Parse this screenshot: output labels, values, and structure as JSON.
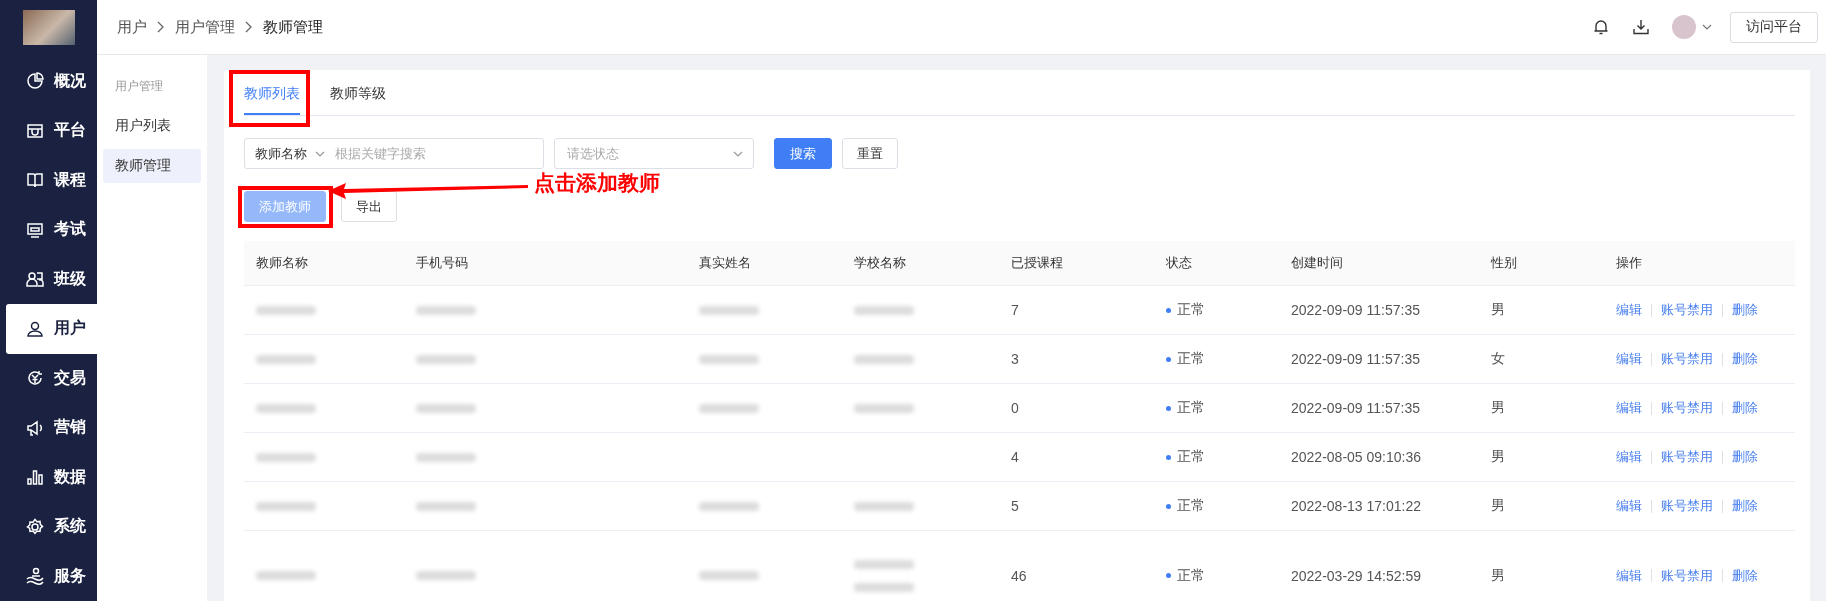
{
  "sidebar": {
    "items": [
      {
        "label": "概况",
        "selected": false
      },
      {
        "label": "平台",
        "selected": false
      },
      {
        "label": "课程",
        "selected": false
      },
      {
        "label": "考试",
        "selected": false
      },
      {
        "label": "班级",
        "selected": false
      },
      {
        "label": "用户",
        "selected": true
      },
      {
        "label": "交易",
        "selected": false
      },
      {
        "label": "营销",
        "selected": false
      },
      {
        "label": "数据",
        "selected": false
      },
      {
        "label": "系统",
        "selected": false
      },
      {
        "label": "服务",
        "selected": false
      }
    ]
  },
  "breadcrumb": [
    "用户",
    "用户管理",
    "教师管理"
  ],
  "header": {
    "button": "访问平台"
  },
  "submenu": {
    "title": "用户管理",
    "items": [
      {
        "label": "用户列表",
        "selected": false
      },
      {
        "label": "教师管理",
        "selected": true
      }
    ]
  },
  "tabs": [
    {
      "label": "教师列表",
      "selected": true,
      "highlighted": true
    },
    {
      "label": "教师等级",
      "selected": false,
      "highlighted": false
    }
  ],
  "filters": {
    "field_select": "教师名称",
    "keyword": {
      "placeholder": "根据关键字搜索"
    },
    "status": {
      "placeholder": "请选状态"
    },
    "search_button": "搜索",
    "reset_button": "重置"
  },
  "actions": [
    {
      "label": "添加教师",
      "kind": "primary",
      "highlighted": true
    },
    {
      "label": "导出",
      "kind": "default",
      "highlighted": false
    }
  ],
  "callout": {
    "text": "点击添加教师"
  },
  "table": {
    "columns": [
      "教师名称",
      "手机号码",
      "真实姓名",
      "学校名称",
      "已授课程",
      "状态",
      "创建时间",
      "性别",
      "操作"
    ],
    "rows": [
      {
        "name": {
          "blurred": true
        },
        "phone": {
          "blurred": true
        },
        "real_name": {
          "blurred": true
        },
        "school": {
          "blurred": true
        },
        "courses": "7",
        "status": "正常",
        "created": "2022-09-09 11:57:35",
        "gender": "男",
        "ops": [
          "编辑",
          "账号禁用",
          "删除"
        ]
      },
      {
        "name": {
          "blurred": true
        },
        "phone": {
          "blurred": true
        },
        "real_name": {
          "blurred": true
        },
        "school": {
          "blurred": true
        },
        "courses": "3",
        "status": "正常",
        "created": "2022-09-09 11:57:35",
        "gender": "女",
        "ops": [
          "编辑",
          "账号禁用",
          "删除"
        ]
      },
      {
        "name": {
          "blurred": true
        },
        "phone": {
          "blurred": true
        },
        "real_name": {
          "blurred": true
        },
        "school": {
          "blurred": true
        },
        "courses": "0",
        "status": "正常",
        "created": "2022-09-09 11:57:35",
        "gender": "男",
        "ops": [
          "编辑",
          "账号禁用",
          "删除"
        ]
      },
      {
        "name": {
          "blurred": true
        },
        "phone": {
          "blurred": true
        },
        "courses": "4",
        "status": "正常",
        "created": "2022-08-05 09:10:36",
        "gender": "男",
        "ops": [
          "编辑",
          "账号禁用",
          "删除"
        ]
      },
      {
        "name": {
          "blurred": true
        },
        "phone": {
          "blurred": true
        },
        "real_name": {
          "blurred": true
        },
        "school": {
          "blurred": true
        },
        "courses": "5",
        "status": "正常",
        "created": "2022-08-13 17:01:22",
        "gender": "男",
        "ops": [
          "编辑",
          "账号禁用",
          "删除"
        ]
      },
      {
        "name": {
          "blurred": true
        },
        "phone": {
          "blurred": true
        },
        "real_name": {
          "blurred": true
        },
        "school": {
          "blurred": true,
          "wrapped": true
        },
        "courses": "46",
        "status": "正常",
        "created": "2022-03-29 14:52:59",
        "gender": "男",
        "ops": [
          "编辑",
          "账号禁用",
          "删除"
        ]
      }
    ]
  }
}
